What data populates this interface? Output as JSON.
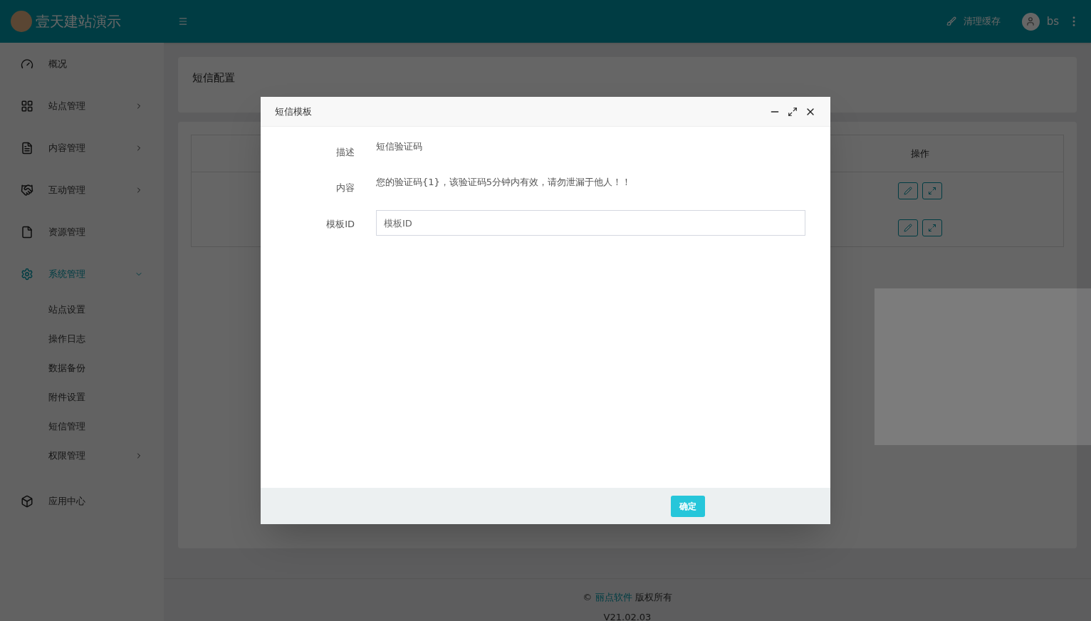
{
  "header": {
    "brand": "壹天建站演示",
    "clear_cache": "清理缓存",
    "user": "bs"
  },
  "sidebar": {
    "items": [
      {
        "label": "概况",
        "has_submenu": false,
        "expanded": false
      },
      {
        "label": "站点管理",
        "has_submenu": true,
        "expanded": false
      },
      {
        "label": "内容管理",
        "has_submenu": true,
        "expanded": false
      },
      {
        "label": "互动管理",
        "has_submenu": true,
        "expanded": false
      },
      {
        "label": "资源管理",
        "has_submenu": false,
        "expanded": false
      },
      {
        "label": "系统管理",
        "has_submenu": true,
        "expanded": true,
        "children": [
          {
            "label": "站点设置",
            "has_submenu": false
          },
          {
            "label": "操作日志",
            "has_submenu": false
          },
          {
            "label": "数据备份",
            "has_submenu": false
          },
          {
            "label": "附件设置",
            "has_submenu": false
          },
          {
            "label": "短信管理",
            "has_submenu": false
          },
          {
            "label": "权限管理",
            "has_submenu": true
          }
        ]
      },
      {
        "label": "应用中心",
        "has_submenu": false,
        "expanded": false
      }
    ]
  },
  "page": {
    "title": "短信配置",
    "table": {
      "columns": [
        "操作"
      ],
      "rows": [
        {
          "actions": [
            {
              "kind": "edit"
            },
            {
              "kind": "fullscreen"
            }
          ]
        },
        {
          "actions": [
            {
              "kind": "edit"
            },
            {
              "kind": "fullscreen"
            }
          ]
        }
      ]
    }
  },
  "modal": {
    "title": "短信模板",
    "fields": [
      {
        "label": "描述",
        "kind": "text",
        "value": "短信验证码"
      },
      {
        "label": "内容",
        "kind": "text",
        "value": "您的验证码{1}，该验证码5分钟内有效，请勿泄漏于他人！！"
      },
      {
        "label": "模板ID",
        "kind": "input",
        "placeholder": "模板ID"
      }
    ],
    "confirm": "确定"
  },
  "footer": {
    "copyright_prefix": "©",
    "company": "丽点软件",
    "copyright_suffix": "版权所有",
    "version": "V21.02.03"
  }
}
